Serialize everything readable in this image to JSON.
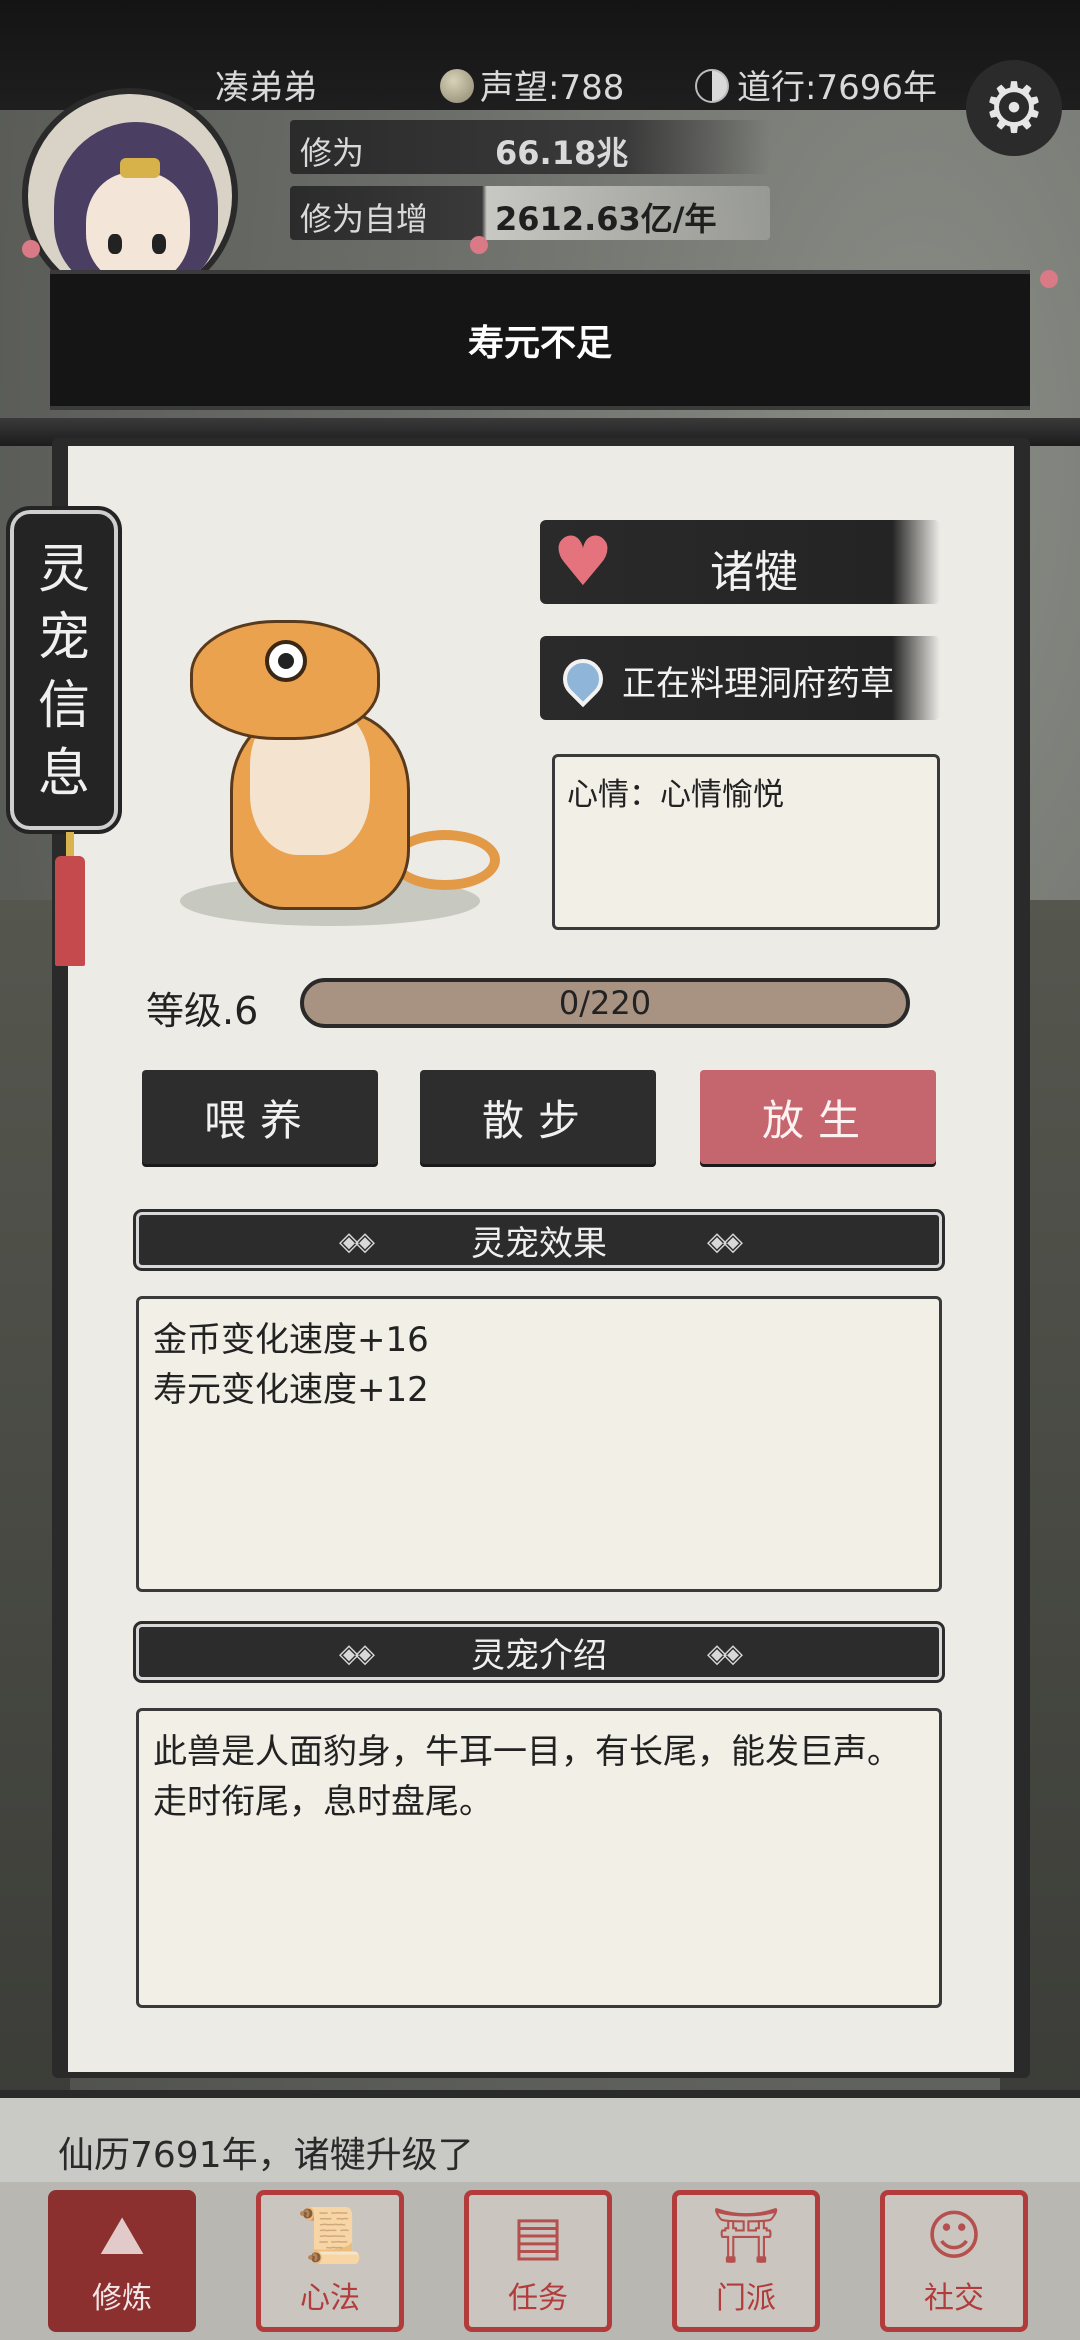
{
  "status": {
    "player_name": "凑弟弟",
    "fame_label": "声望:788",
    "dao_label": "道行:7696年"
  },
  "cultivation": {
    "row1_label": "修为",
    "row1_value": "66.18兆",
    "row2_label": "修为自增",
    "row2_value": "2612.63亿/年"
  },
  "toast": {
    "message": "寿元不足"
  },
  "side_tab": {
    "title": "灵宠信息"
  },
  "pet": {
    "name": "诸犍",
    "activity": "正在料理洞府药草",
    "mood": "心情：心情愉悦",
    "level_label": "等级.6",
    "xp_text": "0/220",
    "xp_fraction": 0.0
  },
  "actions": {
    "feed": "喂养",
    "walk": "散步",
    "release": "放生"
  },
  "effects": {
    "header": "灵宠效果",
    "lines": [
      "金币变化速度+16",
      "寿元变化速度+12"
    ]
  },
  "intro": {
    "header": "灵宠介绍",
    "text": "此兽是人面豹身，牛耳一目，有长尾，能发巨声。走时衔尾，息时盘尾。"
  },
  "log": {
    "latest": "仙历7691年，诸犍升级了"
  },
  "nav": [
    {
      "label": "修炼",
      "icon": "cultivate-icon",
      "active": true
    },
    {
      "label": "心法",
      "icon": "scroll-icon",
      "active": false
    },
    {
      "label": "任务",
      "icon": "task-icon",
      "active": false
    },
    {
      "label": "门派",
      "icon": "sect-icon",
      "active": false
    },
    {
      "label": "社交",
      "icon": "social-icon",
      "active": false
    }
  ],
  "colors": {
    "accent_red": "#c5656e",
    "nav_red": "#b23c3c",
    "paper": "#ecebe6",
    "ink": "#2a2a2a"
  }
}
